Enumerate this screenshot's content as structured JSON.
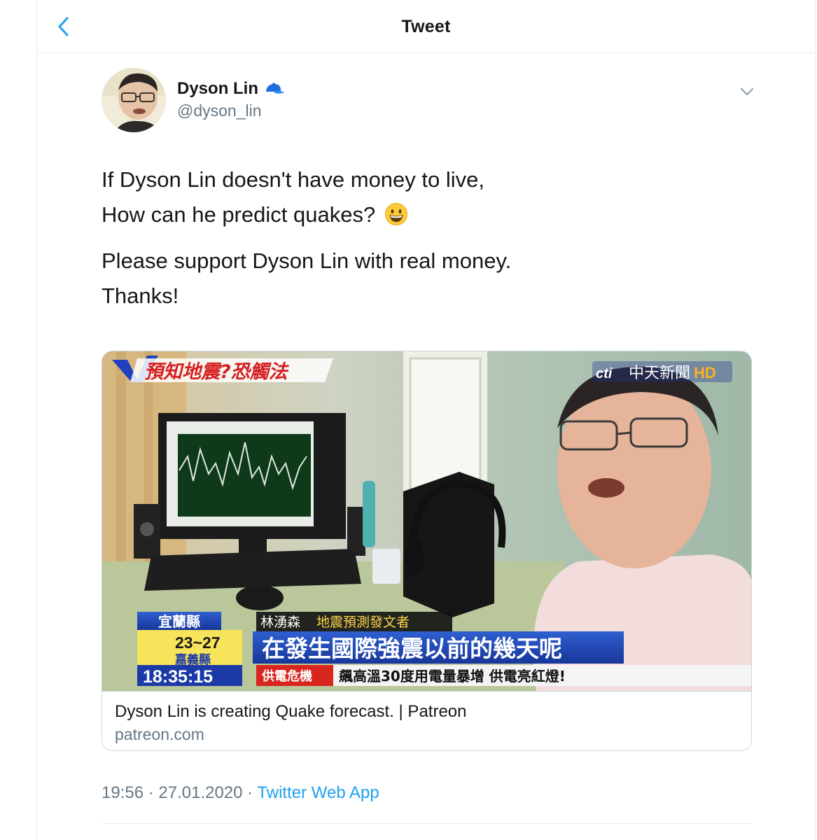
{
  "header": {
    "title": "Tweet"
  },
  "author": {
    "name": "Dyson Lin",
    "handle": "@dyson_lin",
    "badge_icon": "blue-cap-icon"
  },
  "tweet": {
    "line1": "If Dyson Lin doesn't have money to live,",
    "line2": "How can he predict quakes?",
    "emoji": "grinning-face-emoji",
    "line3": "Please support Dyson Lin with real money.",
    "line4": "Thanks!"
  },
  "card": {
    "title": "Dyson Lin is creating Quake forecast. | Patreon",
    "domain": "patreon.com",
    "overlay": {
      "topic": "預知地震?恐觸法",
      "channel": "中天新聞",
      "channel_hd": "HD",
      "channel_prefix": "cti",
      "location_top": "宜蘭縣",
      "temp": "23~27",
      "location_bottom": "嘉義縣",
      "clock": "18:35:15",
      "speaker_name": "林湧森",
      "speaker_role": "地震預測發文者",
      "subtitle": "在發生國際強震以前的幾天呢",
      "ticker_tag": "供電危機",
      "ticker_text": "飆高溫30度用電量暴增 供電亮紅燈!"
    }
  },
  "meta": {
    "time": "19:56 · 27.01.2020 · ",
    "source": "Twitter Web App"
  },
  "colors": {
    "link": "#1da1f2",
    "secondary": "#657786",
    "border": "#e6ecf0"
  }
}
